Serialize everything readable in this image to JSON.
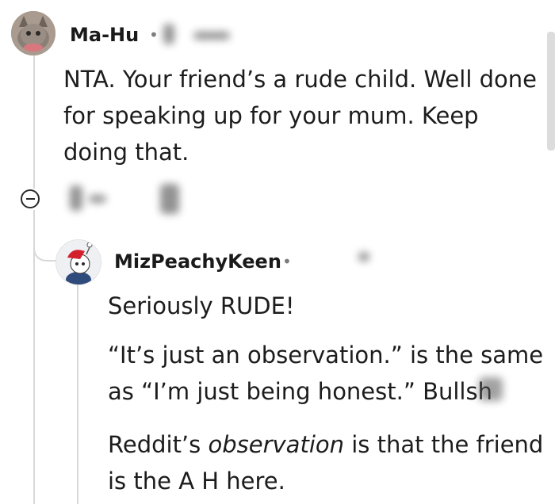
{
  "comment": {
    "username": "Ma-Hu",
    "separator": "•",
    "body": "NTA. Your friend’s a rude child. Well done for speaking up for your mum. Keep doing that.",
    "body_lines": [
      "NTA. Your friend’s a rude child. Well done",
      "for speaking up for your mum. Keep",
      "doing that."
    ]
  },
  "reply": {
    "username": "MizPeachyKeen",
    "separator": "•",
    "paragraph1": "Seriously RUDE!",
    "paragraph2_line1": "“It’s just an observation.” is the same",
    "paragraph2_line2": "as “I’m just being honest.” Bullsh",
    "paragraph3_line1_start": "Reddit’s ",
    "paragraph3_line1_em": "observation",
    "paragraph3_line1_end": " is that the friend",
    "paragraph3_line2": "is the A H here."
  },
  "icons": {
    "collapse": "collapse-thread-icon",
    "upvote": "upvote-icon",
    "downvote": "downvote-icon"
  }
}
